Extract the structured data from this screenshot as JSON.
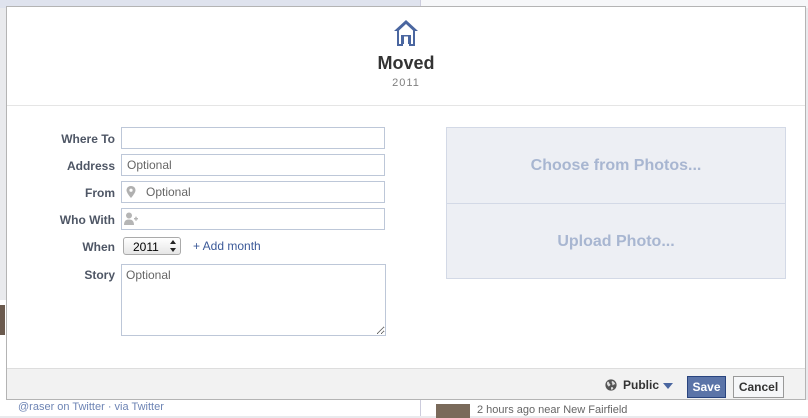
{
  "background": {
    "bottom_left_text": "@raser on Twitter · via Twitter",
    "bottom_right_text": "2 hours ago near New Fairfield"
  },
  "header": {
    "icon": "home-icon",
    "title": "Moved",
    "year": "2011"
  },
  "form": {
    "where_to": {
      "label": "Where To",
      "value": "",
      "placeholder": ""
    },
    "address": {
      "label": "Address",
      "value": "",
      "placeholder": "Optional"
    },
    "from": {
      "label": "From",
      "value": "",
      "placeholder": "Optional",
      "icon": "location-pin-icon"
    },
    "who_with": {
      "label": "Who With",
      "value": "",
      "placeholder": "",
      "icon": "add-person-icon"
    },
    "when": {
      "label": "When",
      "year": "2011",
      "add_month": "+ Add month"
    },
    "story": {
      "label": "Story",
      "value": "",
      "placeholder": "Optional"
    }
  },
  "photos": {
    "choose": "Choose from Photos...",
    "upload": "Upload Photo..."
  },
  "footer": {
    "privacy": "Public",
    "privacy_icon": "globe-icon",
    "save": "Save",
    "cancel": "Cancel"
  },
  "colors": {
    "accent": "#3b5998",
    "save_button": "#5b74a8",
    "photo_text": "#a8b6d1"
  }
}
